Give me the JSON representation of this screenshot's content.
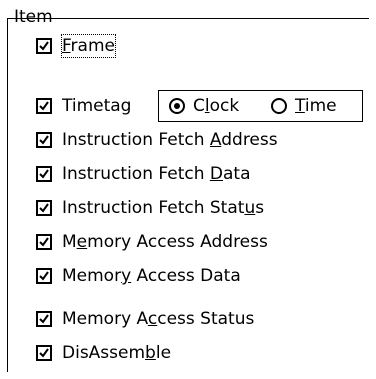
{
  "group": {
    "title": "Item"
  },
  "items": [
    {
      "pre": "",
      "u": "F",
      "post": "rame",
      "checked": true
    },
    {
      "pre": "Timetag",
      "u": "",
      "post": "",
      "checked": true
    },
    {
      "pre": "Instruction Fetch ",
      "u": "A",
      "post": "ddress",
      "checked": true
    },
    {
      "pre": "Instruction Fetch ",
      "u": "D",
      "post": "ata",
      "checked": true
    },
    {
      "pre": "Instruction Fetch Stat",
      "u": "u",
      "post": "s",
      "checked": true
    },
    {
      "pre": "M",
      "u": "e",
      "post": "mory Access Address",
      "checked": true
    },
    {
      "pre": "Memor",
      "u": "y",
      "post": " Access Data",
      "checked": true
    },
    {
      "pre": "Memory A",
      "u": "c",
      "post": "cess Status",
      "checked": true
    },
    {
      "pre": "DisAssem",
      "u": "b",
      "post": "le",
      "checked": true
    }
  ],
  "timetag_options": [
    {
      "pre": "C",
      "u": "l",
      "post": "ock",
      "selected": true
    },
    {
      "pre": "",
      "u": "T",
      "post": "ime",
      "selected": false
    }
  ]
}
